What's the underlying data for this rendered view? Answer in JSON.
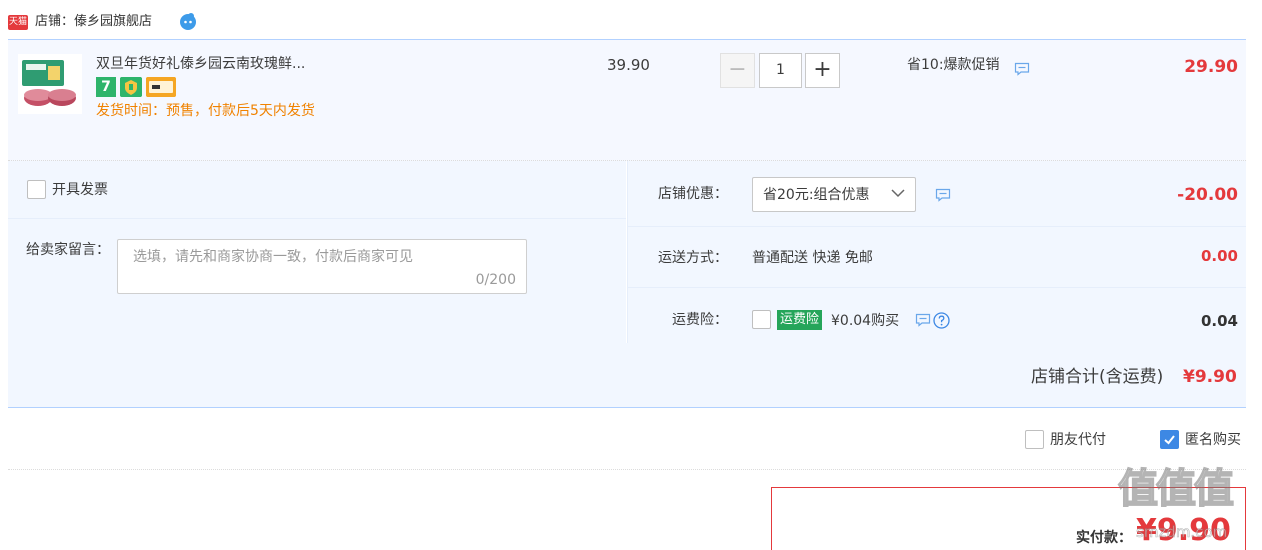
{
  "shop": {
    "badge": "天猫",
    "name": "店铺：傣乡园旗舰店"
  },
  "item": {
    "title": "双旦年货好礼傣乡园云南玫瑰鲜...",
    "service_badge": "7",
    "ship_time": "发货时间：预售，付款后5天内发货",
    "original_price": "39.90",
    "quantity": "1",
    "minus_label": "−",
    "plus_label": "+",
    "promotion": "省10:爆款促销",
    "price": "29.90"
  },
  "invoice": {
    "label": "开具发票"
  },
  "message": {
    "label": "给卖家留言：",
    "placeholder": "选填，请先和商家协商一致，付款后商家可见",
    "counter": "0/200"
  },
  "discount": {
    "label": "店铺优惠：",
    "selected": "省20元:组合优惠",
    "amount": "-20.00"
  },
  "shipping": {
    "label": "运送方式：",
    "method": "普通配送 快递 免邮",
    "amount": "0.00"
  },
  "insurance": {
    "label": "运费险：",
    "tag": "运费险",
    "price_text": "¥0.04购买",
    "amount": "0.04"
  },
  "store_total": {
    "label": "店铺合计(含运费)",
    "value": "¥9.90"
  },
  "options": {
    "friend_pay": "朋友代付",
    "anonymous": "匿名购买",
    "friend_pay_checked": false,
    "anonymous_checked": true
  },
  "payment": {
    "label": "实付款：",
    "value": "¥9.90"
  },
  "watermark": {
    "text": "值值值",
    "url": "smzdm.com"
  },
  "colors": {
    "price_red": "#e4393c",
    "ship_orange": "#f08200",
    "panel_bg": "#f2f7ff",
    "check_blue": "#3d88e4",
    "insurance_green": "#25a55a"
  }
}
